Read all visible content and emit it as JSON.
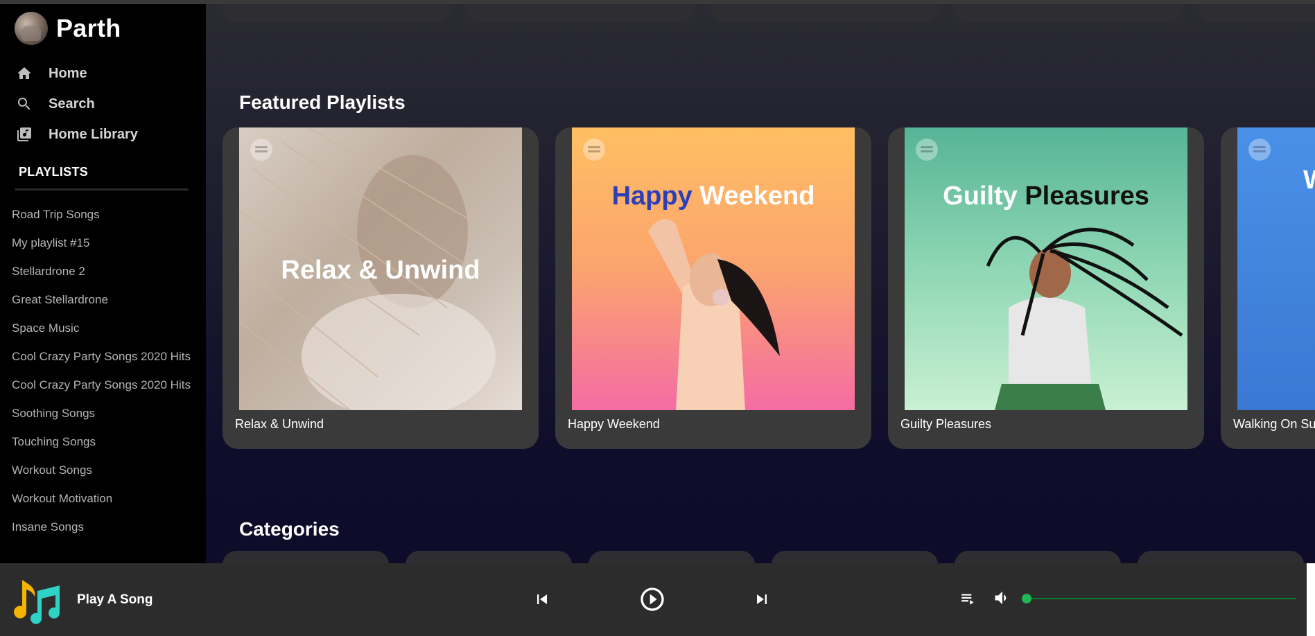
{
  "user": {
    "name": "Parth"
  },
  "nav": [
    {
      "label": "Home",
      "icon": "home-icon"
    },
    {
      "label": "Search",
      "icon": "search-icon"
    },
    {
      "label": "Home Library",
      "icon": "library-icon"
    }
  ],
  "playlists": {
    "heading": "PLAYLISTS",
    "items": [
      "Road Trip Songs",
      "My playlist #15",
      "Stellardrone 2",
      "Great Stellardrone",
      "Space Music",
      "Cool Crazy Party Songs 2020 Hits",
      "Cool Crazy Party Songs 2020 Hits",
      "Soothing Songs",
      "Touching Songs",
      "Workout Songs",
      "Workout Motivation",
      "Insane Songs"
    ]
  },
  "featured": {
    "title": "Featured Playlists",
    "cards": [
      {
        "caption": "Relax & Unwind",
        "cover_text": "Relax & Unwind"
      },
      {
        "caption": "Happy Weekend",
        "cover_text_a": "Happy",
        "cover_text_b": "Weekend"
      },
      {
        "caption": "Guilty Pleasures",
        "cover_text_a": "Guilty",
        "cover_text_b": "Pleasures"
      },
      {
        "caption": "Walking On Su",
        "cover_text": "W"
      }
    ]
  },
  "categories": {
    "title": "Categories"
  },
  "player": {
    "song_title": "Play A Song",
    "volume_level": 0,
    "accent": "#1db954"
  }
}
